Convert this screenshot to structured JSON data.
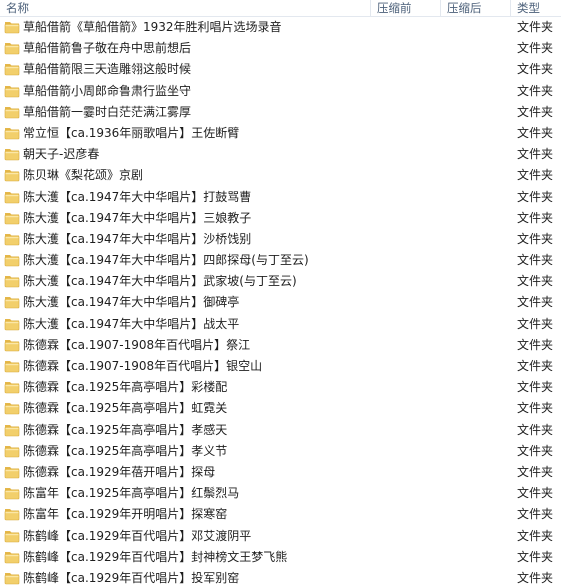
{
  "columns": {
    "name": "名称",
    "compression_ratio": "压缩前",
    "compressed": "压缩后",
    "type": "类型"
  },
  "rows": [
    {
      "name": "草船借箭《草船借箭》1932年胜利唱片选场录音",
      "type": "文件夹"
    },
    {
      "name": "草船借箭鲁子敬在舟中思前想后",
      "type": "文件夹"
    },
    {
      "name": "草船借箭限三天造雕翎这般时候",
      "type": "文件夹"
    },
    {
      "name": "草船借箭小周郎命鲁肃行监坐守",
      "type": "文件夹"
    },
    {
      "name": "草船借箭一霎时白茫茫满江雾厚",
      "type": "文件夹"
    },
    {
      "name": "常立恒【ca.1936年丽歌唱片】王佐断臂",
      "type": "文件夹"
    },
    {
      "name": "朝天子-迟彦春",
      "type": "文件夹"
    },
    {
      "name": "陈贝琳《梨花颂》京剧",
      "type": "文件夹"
    },
    {
      "name": "陈大濩【ca.1947年大中华唱片】打鼓骂曹",
      "type": "文件夹"
    },
    {
      "name": "陈大濩【ca.1947年大中华唱片】三娘教子",
      "type": "文件夹"
    },
    {
      "name": "陈大濩【ca.1947年大中华唱片】沙桥饯别",
      "type": "文件夹"
    },
    {
      "name": "陈大濩【ca.1947年大中华唱片】四郎探母(与丁至云)",
      "type": "文件夹"
    },
    {
      "name": "陈大濩【ca.1947年大中华唱片】武家坡(与丁至云)",
      "type": "文件夹"
    },
    {
      "name": "陈大濩【ca.1947年大中华唱片】御碑亭",
      "type": "文件夹"
    },
    {
      "name": "陈大濩【ca.1947年大中华唱片】战太平",
      "type": "文件夹"
    },
    {
      "name": "陈德霖【ca.1907-1908年百代唱片】祭江",
      "type": "文件夹"
    },
    {
      "name": "陈德霖【ca.1907-1908年百代唱片】银空山",
      "type": "文件夹"
    },
    {
      "name": "陈德霖【ca.1925年高亭唱片】彩楼配",
      "type": "文件夹"
    },
    {
      "name": "陈德霖【ca.1925年高亭唱片】虹霓关",
      "type": "文件夹"
    },
    {
      "name": "陈德霖【ca.1925年高亭唱片】孝感天",
      "type": "文件夹"
    },
    {
      "name": "陈德霖【ca.1925年高亭唱片】孝义节",
      "type": "文件夹"
    },
    {
      "name": "陈德霖【ca.1929年蓓开唱片】探母",
      "type": "文件夹"
    },
    {
      "name": "陈富年【ca.1925年高亭唱片】红鬃烈马",
      "type": "文件夹"
    },
    {
      "name": "陈富年【ca.1929年开明唱片】探寒窑",
      "type": "文件夹"
    },
    {
      "name": "陈鹤峰【ca.1929年百代唱片】邓艾渡阴平",
      "type": "文件夹"
    },
    {
      "name": "陈鹤峰【ca.1929年百代唱片】封神榜文王梦飞熊",
      "type": "文件夹"
    },
    {
      "name": "陈鹤峰【ca.1929年百代唱片】投军别窑",
      "type": "文件夹"
    }
  ],
  "colors": {
    "folder_body": "#f2cf6b",
    "folder_tab": "#e5b84b",
    "header_text": "#4c607a"
  }
}
